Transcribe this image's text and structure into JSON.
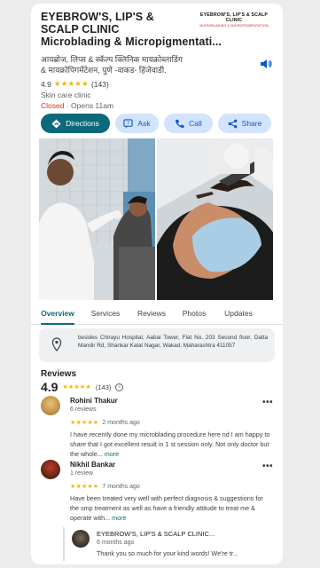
{
  "business": {
    "name": "EYEBROW'S, LIP'S & SCALP CLINIC Microblading & Micropigmentati...",
    "name_line1": "EYEBROW'S, LIP'S &",
    "name_line2": "SCALP CLINIC",
    "name_line3": "Microblading & Micropigmentati...",
    "logo_main": "EYEBROW'S, LIP'S & SCALP CLINIC",
    "logo_sub": "MICROBLADING & MICROPIGMENTATION",
    "native_name_line1": "आयब्रोज, लिप्स & स्कॅल्प क्लिनिक मायक्रोब्लाडिंग",
    "native_name_line2": "& मायक्रोपिगमेंटेशन, पुणे -वाकड- हिंजेवाडी.",
    "rating": "4.9",
    "stars": "★★★★★",
    "review_count": "(143)",
    "category": "Skin care clinic",
    "status_closed": "Closed",
    "status_open": " · Opens 11am"
  },
  "actions": {
    "directions": "Directions",
    "ask": "Ask",
    "call": "Call",
    "share": "Share"
  },
  "tabs": [
    "Overview",
    "Services",
    "Reviews",
    "Photos",
    "Updates"
  ],
  "address": "besides Chirayu Hospital, Aabai Tower, Flat No. 203 Second floor, Datta Mandir Rd, Shankar Kalat Nagar, Wakad, Maharashtra 411057",
  "reviews_section": {
    "title": "Reviews",
    "score": "4.9",
    "stars": "★★★★★",
    "count": "(143)",
    "info": "i"
  },
  "reviews": [
    {
      "author": "Rohini Thakur",
      "sub": "6 reviews",
      "stars": "★★★★★",
      "time": "2 months ago",
      "text": "I have recently done my microblading procedure here nd I am happy to share that I got excellent result in 1 st session only. Not only doctor but the whole...",
      "more": "more"
    },
    {
      "author": "Nikhil Bankar",
      "sub": "1 review",
      "stars": "★★★★★",
      "time": "7 months ago",
      "text": "Have been treated very well with perfect diagnosis & suggestions for the smp treatment as well as have a friendly attitude to treat me & operate with...",
      "more": "more"
    }
  ],
  "reply": {
    "author": "EYEBROW'S, LIP'S & SCALP CLINIC...",
    "time": "6 months ago",
    "text": "Thank you so much for your kind words! We're tr..."
  },
  "menu_dots": "•••",
  "colors": {
    "accent": "#0b6a7a",
    "chip_bg": "#d2e3fc",
    "chip_text": "#0b57d0",
    "closed": "#d93025",
    "star": "#f4b400"
  },
  "icons": [
    "speaker-icon",
    "directions-icon",
    "ask-icon",
    "call-icon",
    "share-icon",
    "location-pin-icon",
    "info-icon",
    "more-options-icon"
  ]
}
